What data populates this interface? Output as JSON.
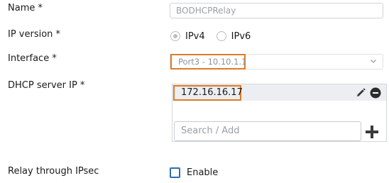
{
  "form": {
    "name": {
      "label": "Name *",
      "value": "BODHCPRelay"
    },
    "ip_version": {
      "label": "IP version *",
      "options": [
        "IPv4",
        "IPv6"
      ],
      "selected": "IPv4"
    },
    "interface": {
      "label": "Interface *",
      "value": "Port3 - 10.10.1.1"
    },
    "dhcp_server_ip": {
      "label": "DHCP server IP *",
      "entries": [
        "172.16.16.17"
      ],
      "search_placeholder": "Search / Add"
    },
    "relay_through_ipsec": {
      "label": "Relay through IPsec",
      "checkbox_label": "Enable",
      "checked": false
    }
  },
  "colors": {
    "highlight": "#e07b24",
    "checkbox_border": "#2f6db5",
    "icon": "#3a3a3a"
  },
  "icons": {
    "edit": "pencil-icon",
    "remove": "minus-circle-icon",
    "add": "plus-icon",
    "dropdown": "chevron-down-icon"
  }
}
